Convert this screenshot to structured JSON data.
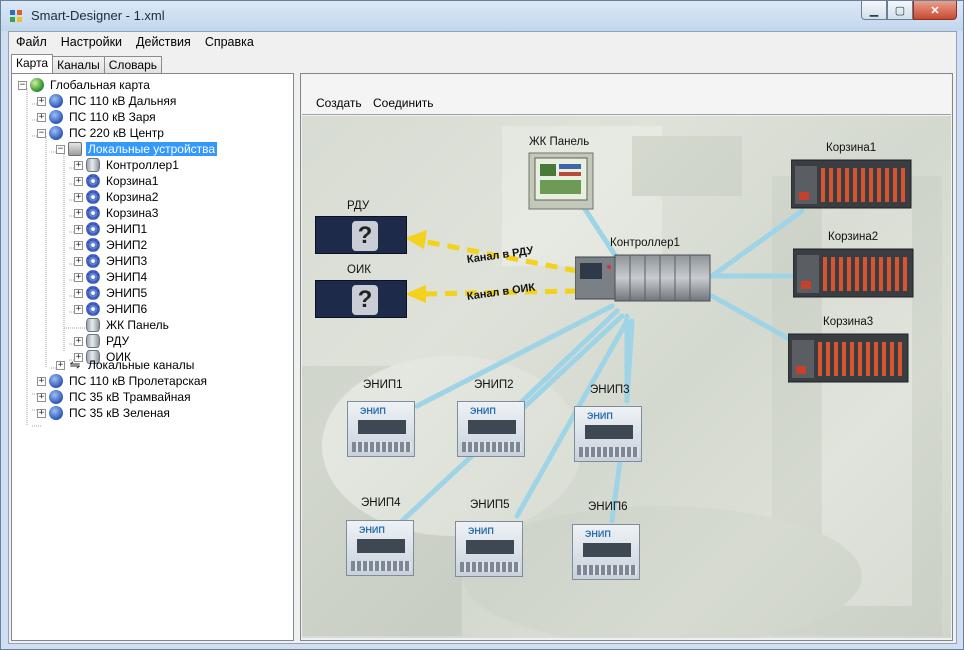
{
  "window": {
    "title": "Smart-Designer - 1.xml"
  },
  "menu": {
    "items": [
      "Файл",
      "Настройки",
      "Действия",
      "Справка"
    ]
  },
  "tabs": [
    {
      "label": "Карта",
      "active": true
    },
    {
      "label": "Каналы",
      "active": false
    },
    {
      "label": "Словарь",
      "active": false
    }
  ],
  "tree": {
    "root": "Глобальная карта",
    "station_1": "ПС 110 кВ Дальняя",
    "station_2": "ПС 110 кВ Заря",
    "station_3": "ПС 220 кВ Центр",
    "local_devices": "Локальные устройства",
    "controller": "Контроллер1",
    "basket_1": "Корзина1",
    "basket_2": "Корзина2",
    "basket_3": "Корзина3",
    "enip_1": "ЭНИП1",
    "enip_2": "ЭНИП2",
    "enip_3": "ЭНИП3",
    "enip_4": "ЭНИП4",
    "enip_5": "ЭНИП5",
    "enip_6": "ЭНИП6",
    "lcd_panel": "ЖК Панель",
    "rdu": "РДУ",
    "oik": "ОИК",
    "local_channels": "Локальные каналы",
    "station_4": "ПС 110 кВ Пролетарская",
    "station_5": "ПС 35 кВ Трамвайная",
    "station_6": "ПС 35 кВ Зеленая"
  },
  "toolbar": {
    "create": "Создать",
    "connect": "Соединить"
  },
  "map": {
    "lcd_panel": "ЖК Панель",
    "controller": "Контроллер1",
    "basket_1": "Корзина1",
    "basket_2": "Корзина2",
    "basket_3": "Корзина3",
    "rdu": "РДУ",
    "oik": "ОИК",
    "channel_rdu": "Канал в РДУ",
    "channel_oik": "Канал в ОИК",
    "enip_1": "ЭНИП1",
    "enip_2": "ЭНИП2",
    "enip_3": "ЭНИП3",
    "enip_4": "ЭНИП4",
    "enip_5": "ЭНИП5",
    "enip_6": "ЭНИП6",
    "enip_device_text": "ЭНИП",
    "unknown_mark": "?"
  },
  "colors": {
    "link_line": "#9fd3e6",
    "channel_arrow": "#f2d21a",
    "selection": "#3399ff",
    "close_button": "#c74a31"
  },
  "icons": {
    "globe": "globe-icon",
    "station": "substation-icon",
    "device_folder": "device-folder-icon",
    "controller": "controller-icon",
    "gear": "gear-icon",
    "usb": "usb-icon"
  }
}
